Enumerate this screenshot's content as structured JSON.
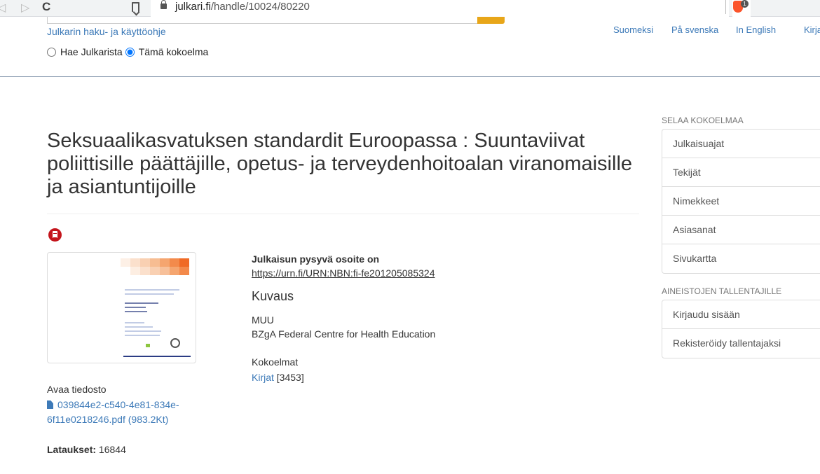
{
  "browser": {
    "url_host": "julkari.fi",
    "url_path": "/handle/10024/80220",
    "extension_badge": "1"
  },
  "header": {
    "help_link": "Julkarin haku- ja käyttöohje",
    "search_scope": {
      "options": [
        {
          "label": "Hae Julkarista",
          "checked": false
        },
        {
          "label": "Tämä kokoelma",
          "checked": true
        }
      ]
    },
    "languages": [
      "Suomeksi",
      "På svenska",
      "In English",
      "Kirja"
    ]
  },
  "item": {
    "title": "Seksuaalikasvatuksen standardit Euroopassa : Suuntaviivat poliittisille päättäjille, opetus- ja terveydenhoitoalan viranomaisille ja asiantuntijoille",
    "file_label": "Avaa tiedosto",
    "file_link": "039844e2-c540-4e81-834e-6f11e0218246.pdf (983.2Kt)",
    "downloads_label": "Lataukset:",
    "downloads_value": "16844",
    "urn_label": "Julkaisun pysyvä osoite on",
    "urn": "https://urn.fi/URN:NBN:fi-fe201205085324",
    "description_heading": "Kuvaus",
    "description_lines": [
      "MUU",
      "BZgA Federal Centre for Health Education"
    ],
    "collections_label": "Kokoelmat",
    "collection_name": "Kirjat",
    "collection_count": "[3453]"
  },
  "sidebar": {
    "browse_heading": "Selaa kokoelmaa",
    "browse_items": [
      "Julkaisuajat",
      "Tekijät",
      "Nimekkeet",
      "Asiasanat",
      "Sivukartta"
    ],
    "depositors_heading": "Aineistojen tallentajille",
    "depositor_items": [
      "Kirjaudu sisään",
      "Rekisteröidy tallentajaksi"
    ]
  },
  "colors": {
    "link": "#3d7ab8",
    "search_button": "#e8a619",
    "pdf_icon": "#c4151c"
  }
}
